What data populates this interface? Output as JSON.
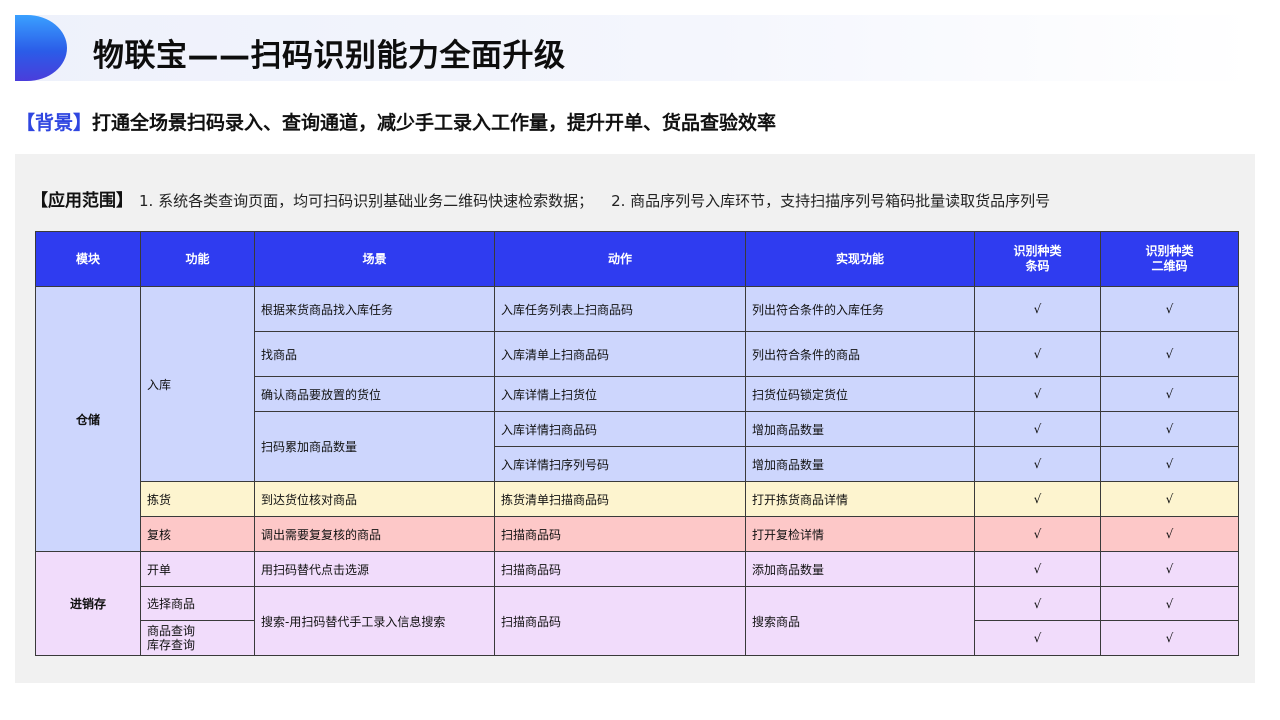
{
  "title": "物联宝——扫码识别能力全面升级",
  "background": {
    "tag": "【背景】",
    "text": "打通全场景扫码录入、查询通道，减少手工录入工作量，提升开单、货品查验效率"
  },
  "scope": {
    "tag": "【应用范围】",
    "item1": "1. 系统各类查询页面，均可扫码识别基础业务二维码快速检索数据；",
    "item2": "2. 商品序列号入库环节，支持扫描序列号箱码批量读取货品序列号"
  },
  "table": {
    "headers": {
      "module": "模块",
      "function": "功能",
      "scene": "场景",
      "action": "动作",
      "feature": "实现功能",
      "barcode_l1": "识别种类",
      "barcode_l2": "条码",
      "qrcode_l1": "识别种类",
      "qrcode_l2": "二维码"
    },
    "module_warehouse": "仓储",
    "module_jxc": "进销存",
    "fn_inbound": "入库",
    "fn_pick": "拣货",
    "fn_check": "复核",
    "fn_order": "开单",
    "fn_select": "选择商品",
    "fn_query_l1": "商品查询",
    "fn_query_l2": "库存查询",
    "rows": {
      "r1": {
        "scene": "根据来货商品找入库任务",
        "action": "入库任务列表上扫商品码",
        "feature": "列出符合条件的入库任务",
        "bar": "√",
        "qr": "√"
      },
      "r2": {
        "scene": "找商品",
        "action": "入库清单上扫商品码",
        "feature": "列出符合条件的商品",
        "bar": "√",
        "qr": "√"
      },
      "r3": {
        "scene": "确认商品要放置的货位",
        "action": "入库详情上扫货位",
        "feature": "扫货位码锁定货位",
        "bar": "√",
        "qr": "√"
      },
      "r4": {
        "scene": "扫码累加商品数量",
        "action": "入库详情扫商品码",
        "feature": "增加商品数量",
        "bar": "√",
        "qr": "√"
      },
      "r5": {
        "action": "入库详情扫序列号码",
        "feature": "增加商品数量",
        "bar": "√",
        "qr": "√"
      },
      "r6": {
        "scene": "到达货位核对商品",
        "action": "拣货清单扫描商品码",
        "feature": "打开拣货商品详情",
        "bar": "√",
        "qr": "√"
      },
      "r7": {
        "scene": "调出需要复复核的商品",
        "action": "扫描商品码",
        "feature": "打开复检详情",
        "bar": "√",
        "qr": "√"
      },
      "r8": {
        "scene": "用扫码替代点击选源",
        "action": "扫描商品码",
        "feature": "添加商品数量",
        "bar": "√",
        "qr": "√"
      },
      "r9": {
        "scene": "搜索-用扫码替代手工录入信息搜索",
        "action": "扫描商品码",
        "feature": "搜索商品",
        "bar": "√",
        "qr": "√"
      },
      "r10": {
        "bar": "√",
        "qr": "√"
      }
    }
  }
}
